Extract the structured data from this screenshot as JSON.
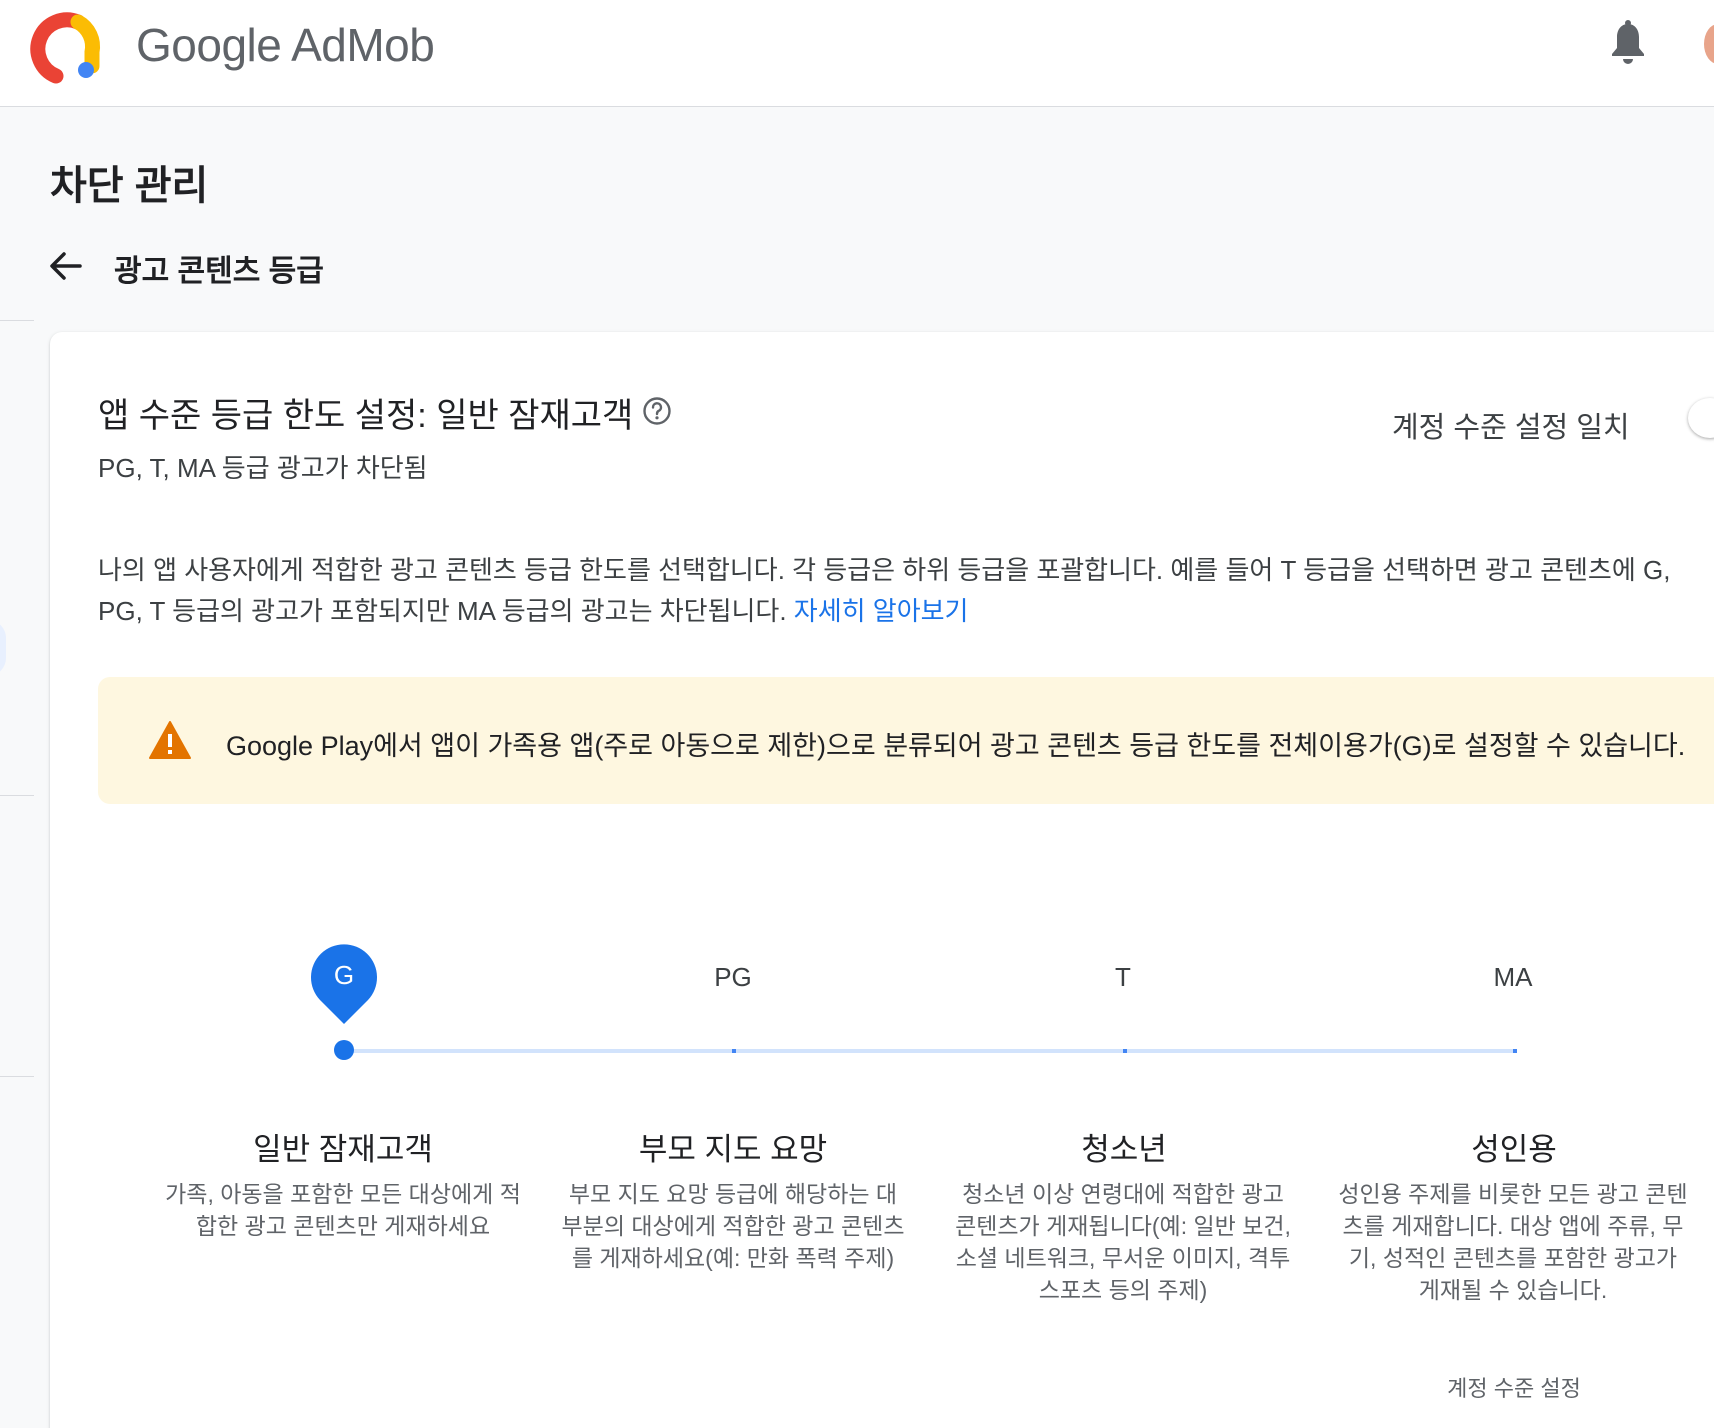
{
  "header": {
    "brand_google": "Google",
    "brand_product": "AdMob"
  },
  "page": {
    "title": "차단 관리",
    "subtitle": "광고 콘텐츠 등급"
  },
  "card": {
    "heading": "앱 수준 등급 한도 설정: 일반 잠재고객",
    "sub": "PG, T, MA 등급 광고가 차단됨",
    "match_label": "계정 수준 설정 일치",
    "description_line1": "나의 앱 사용자에게 적합한 광고 콘텐츠 등급 한도를 선택합니다. 각 등급은 하위 등급을 포괄합니다. 예를 들어 T 등급을 선택하면 광고 콘텐츠에 G,",
    "description_line2": "PG, T 등급의 광고가 포함되지만 MA 등급의 광고는 차단됩니다.",
    "learn_more": "자세히 알아보기",
    "banner": "Google Play에서 앱이 가족용 앱(주로 아동으로 제한)으로 분류되어 광고 콘텐츠 등급 한도를 전체이용가(G)로 설정할 수 있습니다."
  },
  "slider": {
    "selected": "G",
    "levels": [
      {
        "code": "G",
        "name": "일반 잠재고객",
        "desc": "가족, 아동을 포함한 모든 대상에게 적합한 광고 콘텐츠만 게재하세요"
      },
      {
        "code": "PG",
        "name": "부모 지도 요망",
        "desc": "부모 지도 요망 등급에 해당하는 대부분의 대상에게 적합한 광고 콘텐츠를 게재하세요(예: 만화 폭력 주제)"
      },
      {
        "code": "T",
        "name": "청소년",
        "desc": "청소년 이상 연령대에 적합한 광고 콘텐츠가 게재됩니다(예: 일반 보건, 소셜 네트워크, 무서운 이미지, 격투 스포츠 등의 주제)"
      },
      {
        "code": "MA",
        "name": "성인용",
        "desc": "성인용 주제를 비롯한 모든 광고 콘텐츠를 게재합니다. 대상 앱에 주류, 무기, 성적인 콘텐츠를 포함한 광고가 게재될 수 있습니다."
      }
    ],
    "account_tag": "계정 수준 설정"
  },
  "colors": {
    "accent": "#1a73e8",
    "banner_bg": "#fef7e0",
    "warning": "#e37400"
  }
}
